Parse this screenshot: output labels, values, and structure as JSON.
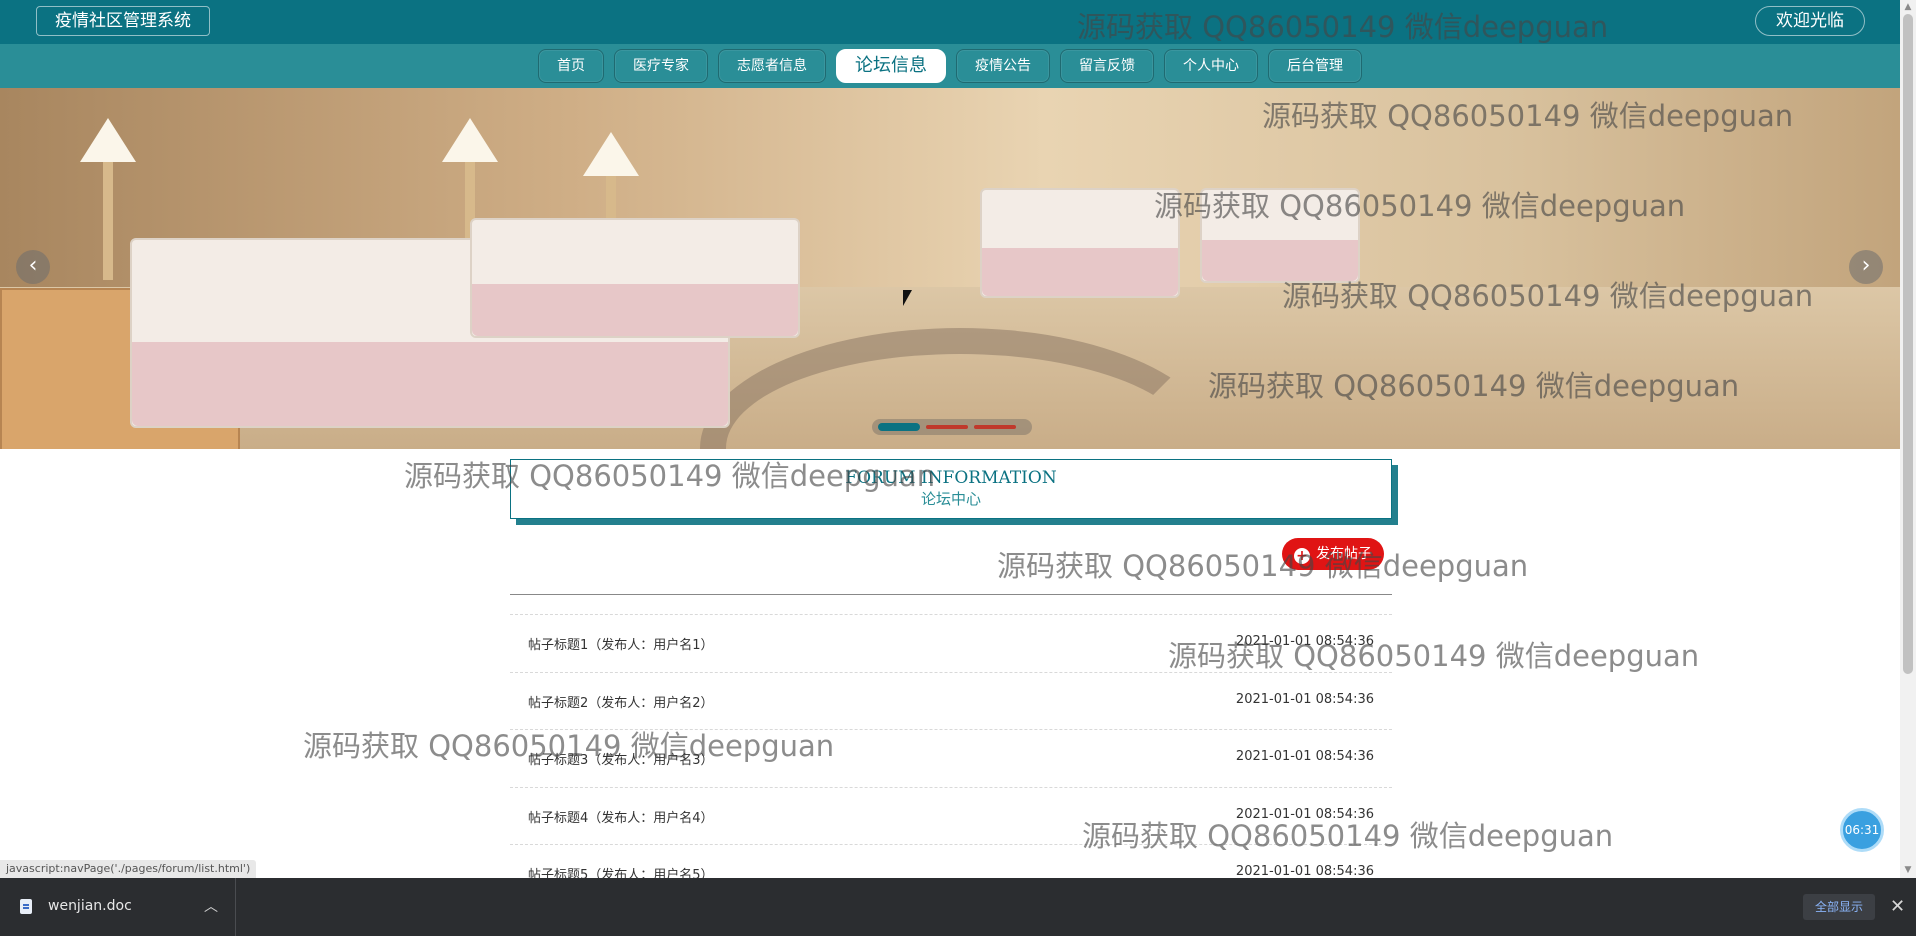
{
  "header": {
    "brand": "疫情社区管理系统",
    "welcome": "欢迎光临"
  },
  "nav": {
    "items": [
      "首页",
      "医疗专家",
      "志愿者信息",
      "论坛信息",
      "疫情公告",
      "留言反馈",
      "个人中心",
      "后台管理"
    ],
    "active_index": 3
  },
  "banner": {
    "prev_icon": "chevron-left-icon",
    "next_icon": "chevron-right-icon",
    "slide_count": 3,
    "active_slide": 1
  },
  "section": {
    "title_en": "FORUM  INFORMATION",
    "title_cn": "论坛中心"
  },
  "post_button": {
    "label": "发布帖子",
    "icon": "plus-icon"
  },
  "posts": [
    {
      "title": "帖子标题1（发布人：用户名1）",
      "time": "2021-01-01 08:54:36"
    },
    {
      "title": "帖子标题2（发布人：用户名2）",
      "time": "2021-01-01 08:54:36"
    },
    {
      "title": "帖子标题3（发布人：用户名3）",
      "time": "2021-01-01 08:54:36"
    },
    {
      "title": "帖子标题4（发布人：用户名4）",
      "time": "2021-01-01 08:54:36"
    },
    {
      "title": "帖子标题5（发布人：用户名5）",
      "time": "2021-01-01 08:54:36"
    }
  ],
  "clock": "06:31",
  "status_url": "javascript:navPage('./pages/forum/list.html')",
  "download_bar": {
    "file_name": "wenjian.doc",
    "show_all": "全部显示",
    "close_icon": "close-icon"
  },
  "watermark_text": "源码获取 QQ86050149 微信deepguan",
  "colors": {
    "primary": "#0b7282",
    "nav_bg": "#2a8e97",
    "accent_red": "#e01414"
  }
}
